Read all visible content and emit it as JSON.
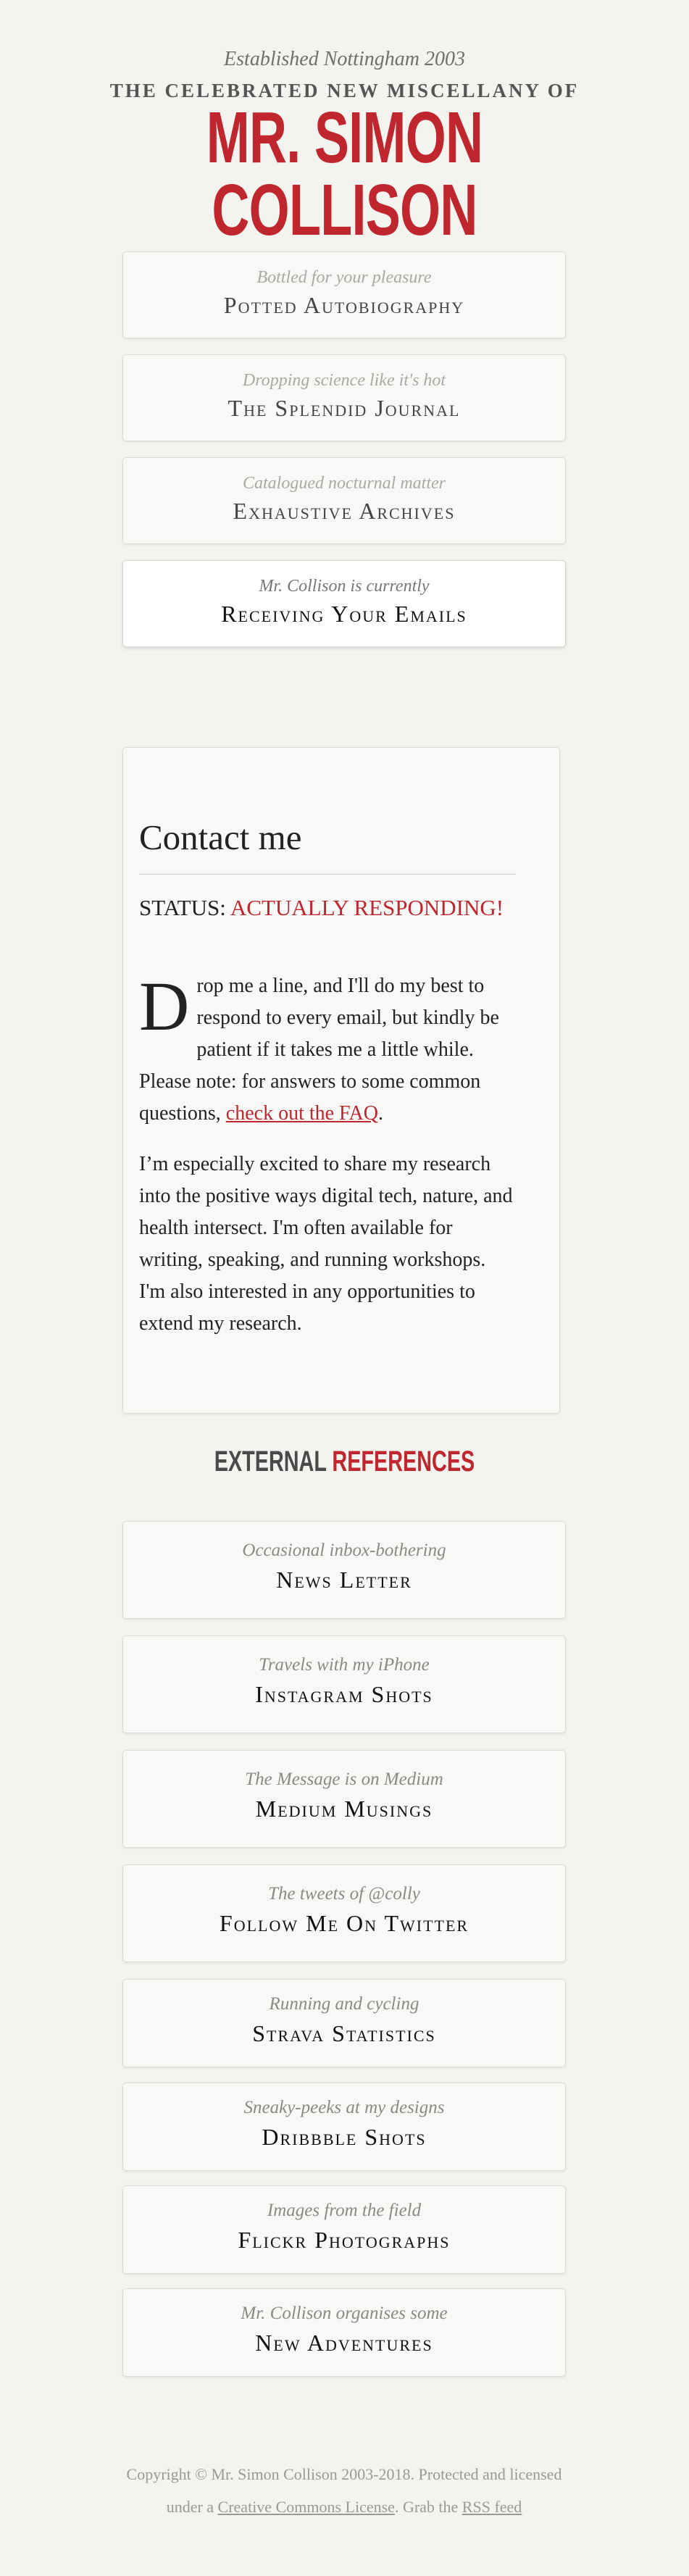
{
  "header": {
    "established": "Established Nottingham 2003",
    "tagline": "THE CELEBRATED NEW MISCELLANY OF",
    "name": "MR. SIMON COLLISON"
  },
  "nav": [
    {
      "sub": "Bottled for your pleasure",
      "title": "Potted Autobiography",
      "active": false
    },
    {
      "sub": "Dropping science like it's hot",
      "title": "The Splendid Journal",
      "active": false
    },
    {
      "sub": "Catalogued nocturnal matter",
      "title": "Exhaustive Archives",
      "active": false
    },
    {
      "sub": "Mr. Collison is currently",
      "title": "Receiving Your Emails",
      "active": true
    }
  ],
  "contact": {
    "heading": "Contact me",
    "status_label": "STATUS:",
    "status_value": "ACTUALLY RESPONDING!",
    "dropcap": "D",
    "p1_text": "rop me a line, and I'll do my best to respond to every email, but kindly be patient if it takes me a little while. Please note: for answers to some common questions, ",
    "p1_link": "check out the FAQ",
    "p1_end": ".",
    "p2": "I’m especially excited to share my research into the positive ways digital tech, nature, and health intersect. I'm often available for writing, speaking, and running workshops. I'm also interested in any opportunities to extend my research."
  },
  "external": {
    "heading_a": "EXTERNAL",
    "heading_b": "REFERENCES",
    "items": [
      {
        "sub": "Occasional inbox-bothering",
        "title": "News Letter"
      },
      {
        "sub": "Travels with my iPhone",
        "title": "Instagram Shots"
      },
      {
        "sub": "The Message is on Medium",
        "title": "Medium Musings"
      },
      {
        "sub": "The tweets of @colly",
        "title": "Follow Me On Twitter"
      },
      {
        "sub": "Running and cycling",
        "title": "Strava Statistics"
      },
      {
        "sub": "Sneaky-peeks at my designs",
        "title": "Dribbble Shots"
      },
      {
        "sub": "Images from the field",
        "title": "Flickr Photographs"
      },
      {
        "sub": "Mr. Collison organises some",
        "title": "New Adventures"
      }
    ]
  },
  "footer": {
    "text1": "Copyright © Mr. Simon Collison 2003-2018. Protected and licensed under a ",
    "cc_link": "Creative Commons License",
    "text2": ". Grab the ",
    "rss_link": "RSS feed"
  }
}
